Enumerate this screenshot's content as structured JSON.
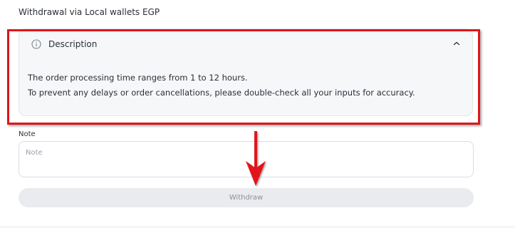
{
  "page_title": "Withdrawal via Local wallets EGP",
  "description": {
    "title": "Description",
    "lines": [
      "The order processing time ranges from 1 to 12 hours.",
      "To prevent any delays or order cancellations, please double-check all your inputs for accuracy."
    ],
    "expanded": true,
    "icons": {
      "leading": "info-icon",
      "toggle": "chevron-up-icon"
    }
  },
  "note": {
    "label": "Note",
    "placeholder": "Note",
    "value": ""
  },
  "withdraw_button": {
    "label": "Withdraw",
    "enabled": false
  },
  "annotation": {
    "highlight_color": "#e0151b",
    "arrow_color": "#e0151b"
  },
  "colors": {
    "card_background": "#f5f7f9",
    "button_background": "#e9ebee",
    "button_text": "#8b9197"
  }
}
